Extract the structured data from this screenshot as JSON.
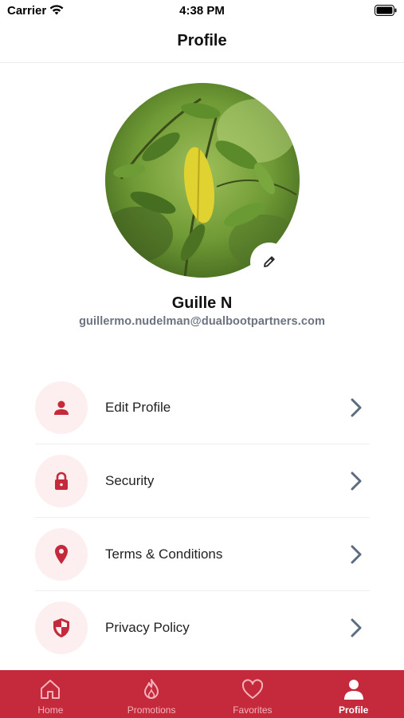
{
  "status_bar": {
    "carrier": "Carrier",
    "time": "4:38 PM"
  },
  "header": {
    "title": "Profile"
  },
  "profile": {
    "name": "Guille N",
    "email": "guillermo.nudelman@dualbootpartners.com"
  },
  "menu": {
    "items": [
      {
        "label": "Edit Profile",
        "icon": "person-icon"
      },
      {
        "label": "Security",
        "icon": "lock-icon"
      },
      {
        "label": "Terms & Conditions",
        "icon": "location-pin-icon"
      },
      {
        "label": "Privacy Policy",
        "icon": "shield-icon"
      }
    ]
  },
  "tab_bar": {
    "items": [
      {
        "label": "Home",
        "icon": "home-icon"
      },
      {
        "label": "Promotions",
        "icon": "flame-icon"
      },
      {
        "label": "Favorites",
        "icon": "heart-icon"
      },
      {
        "label": "Profile",
        "icon": "profile-icon",
        "active": true
      }
    ]
  },
  "colors": {
    "brand": "#c42a3c",
    "icon_bg": "#fdeef0",
    "email_text": "#6b7280",
    "chevron": "#5c6b7d"
  }
}
